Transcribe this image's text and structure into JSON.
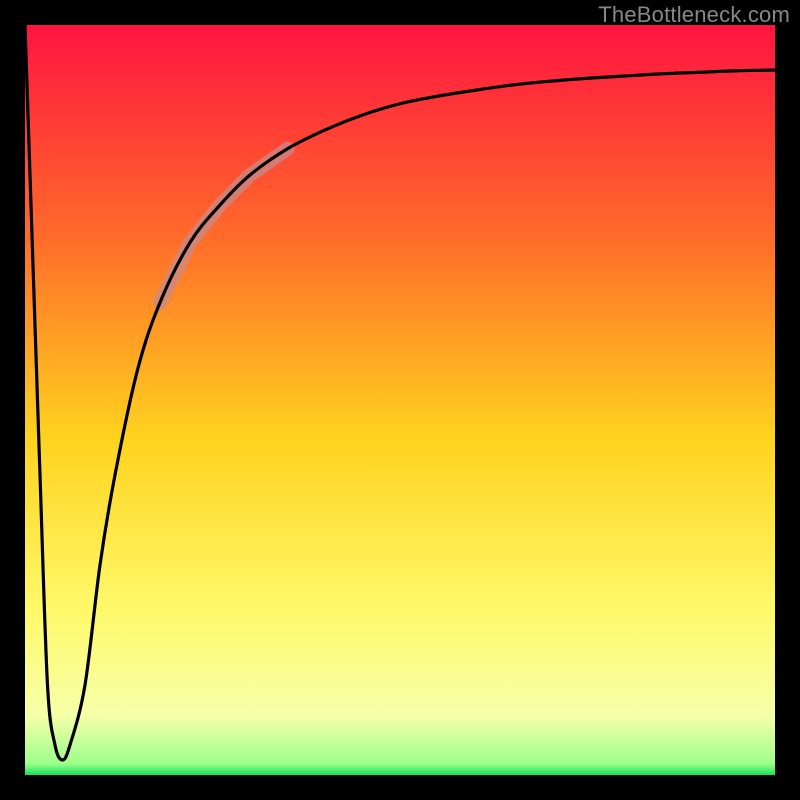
{
  "watermark": "TheBottleneck.com",
  "chart_data": {
    "type": "line",
    "title": "",
    "xlabel": "",
    "ylabel": "",
    "xlim": [
      0,
      100
    ],
    "ylim": [
      0,
      100
    ],
    "grid": false,
    "legend": false,
    "series": [
      {
        "name": "curve",
        "x": [
          0,
          1,
          2,
          3,
          4,
          5,
          6,
          8,
          10,
          12,
          15,
          18,
          22,
          26,
          30,
          35,
          40,
          45,
          50,
          55,
          60,
          65,
          70,
          75,
          80,
          85,
          90,
          95,
          100
        ],
        "values": [
          100,
          70,
          40,
          12,
          4,
          2,
          4,
          12,
          28,
          40,
          54,
          63,
          71,
          76,
          80,
          83.5,
          86,
          88,
          89.5,
          90.5,
          91.3,
          92,
          92.5,
          92.9,
          93.2,
          93.5,
          93.7,
          93.9,
          94.0
        ]
      }
    ],
    "background_gradient": {
      "stops": [
        {
          "pos": 0.0,
          "color": "#ff1440"
        },
        {
          "pos": 0.28,
          "color": "#ff6a2a"
        },
        {
          "pos": 0.55,
          "color": "#ffd21e"
        },
        {
          "pos": 0.78,
          "color": "#fff96a"
        },
        {
          "pos": 0.92,
          "color": "#f6ffa8"
        },
        {
          "pos": 0.985,
          "color": "#9cff8a"
        },
        {
          "pos": 1.0,
          "color": "#18e05a"
        }
      ]
    },
    "curve_color": "#000000",
    "highlight_segment": {
      "x_from": 22,
      "x_to": 30,
      "color": "#c88a8a",
      "width": 14
    }
  }
}
